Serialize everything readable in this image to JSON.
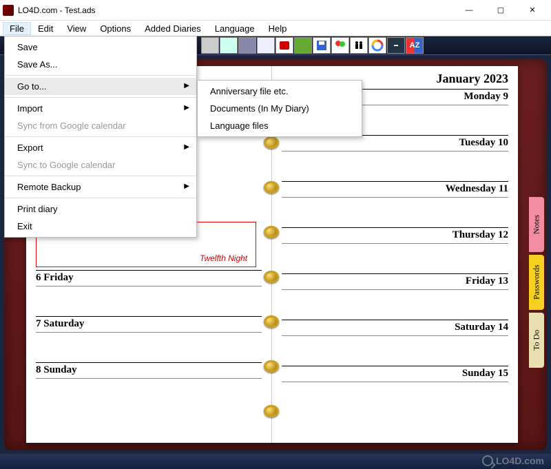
{
  "window": {
    "title": "LO4D.com - Test.ads",
    "minimize": "—",
    "maximize": "▢",
    "close": "✕"
  },
  "menubar": [
    "File",
    "Edit",
    "View",
    "Options",
    "Added Diaries",
    "Language",
    "Help"
  ],
  "file_menu": {
    "save": "Save",
    "save_as": "Save As...",
    "goto": "Go to...",
    "import": "Import",
    "sync_from": "Sync from Google calendar",
    "export": "Export",
    "sync_to": "Sync to Google calendar",
    "remote_backup": "Remote Backup",
    "print": "Print diary",
    "exit": "Exit"
  },
  "goto_submenu": {
    "anniversary": "Anniversary file etc.",
    "documents": "Documents (In My Diary)",
    "language_files": "Language files"
  },
  "diary": {
    "month": "January 2023",
    "left": [
      {
        "label": "6 Friday"
      },
      {
        "label": "7 Saturday"
      },
      {
        "label": "8 Sunday"
      }
    ],
    "right": [
      {
        "label": "Monday 9"
      },
      {
        "label": "Tuesday 10"
      },
      {
        "label": "Wednesday 11"
      },
      {
        "label": "Thursday 12"
      },
      {
        "label": "Friday 13"
      },
      {
        "label": "Saturday 14"
      },
      {
        "label": "Sunday 15"
      }
    ],
    "twelfth_night": "Twelfth Night"
  },
  "sidetabs": {
    "notes": "Notes",
    "passwords": "Passwords",
    "todo": "To Do"
  },
  "watermark": "LO4D.com"
}
